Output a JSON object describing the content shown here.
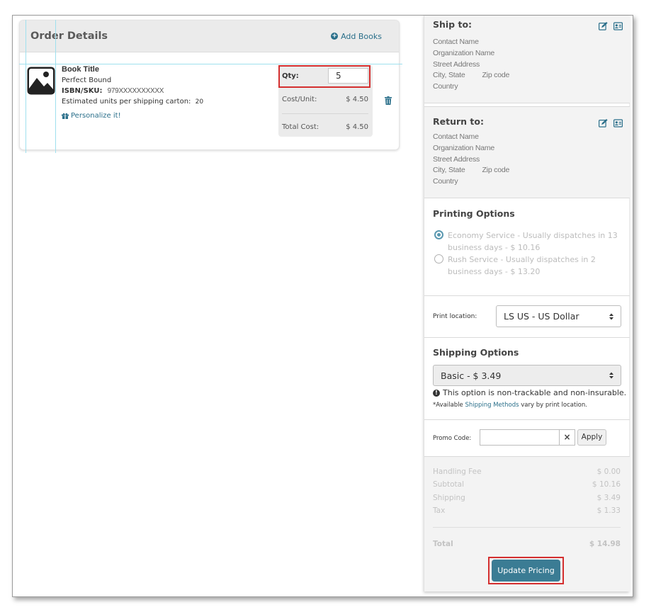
{
  "order": {
    "title": "Order Details",
    "add_books": "Add Books",
    "book": {
      "title": "Book Title",
      "binding": "Perfect Bound",
      "isbn_label": "ISBN/SKU:",
      "isbn_value": "979XXXXXXXXXX",
      "carton_label": "Estimated units per shipping carton:",
      "carton_value": "20",
      "personalize": "Personalize it!"
    },
    "qty_label": "Qty:",
    "qty_value": "5",
    "cost_unit_label": "Cost/Unit:",
    "cost_unit_value": "$ 4.50",
    "total_cost_label": "Total Cost:",
    "total_cost_value": "$ 4.50"
  },
  "ship_to": {
    "title": "Ship to:",
    "contact": "Contact Name",
    "org": "Organization Name",
    "street": "Street Address",
    "city": "City, State",
    "zip": "Zip code",
    "country": "Country"
  },
  "return_to": {
    "title": "Return to:",
    "contact": "Contact Name",
    "org": "Organization Name",
    "street": "Street Address",
    "city": "City, State",
    "zip": "Zip code",
    "country": "Country"
  },
  "printing": {
    "title": "Printing Options",
    "options": [
      {
        "label": "Economy Service - Usually dispatches in 13 business days - $ 10.16",
        "checked": true
      },
      {
        "label": "Rush Service - Usually dispatches in 2 business days - $ 13.20",
        "checked": false
      }
    ]
  },
  "location": {
    "label": "Print location:",
    "value": "LS US - US Dollar"
  },
  "shipping": {
    "title": "Shipping Options",
    "value": "Basic - $ 3.49",
    "note": "This option is non-trackable and non-insurable.",
    "avail_prefix": "*Available",
    "avail_link": "Shipping Methods",
    "avail_suffix": "vary by print location."
  },
  "promo": {
    "label": "Promo Code:",
    "value": "",
    "clear": "×",
    "apply": "Apply"
  },
  "summary": {
    "rows": [
      {
        "label": "Handling Fee",
        "value": "$ 0.00"
      },
      {
        "label": "Subtotal",
        "value": "$ 10.16"
      },
      {
        "label": "Shipping",
        "value": "$ 3.49"
      },
      {
        "label": "Tax",
        "value": "$ 1.33"
      }
    ],
    "total_label": "Total",
    "total_value": "$ 14.98",
    "update_button": "Update Pricing"
  },
  "colors": {
    "accent": "#3b7c94",
    "link": "#2a6f8a",
    "highlight": "#d42f2f"
  }
}
